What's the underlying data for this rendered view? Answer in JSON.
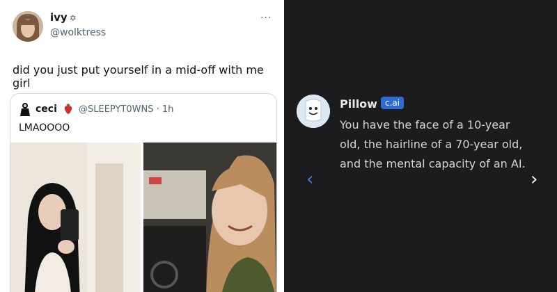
{
  "tweet": {
    "author_name": "ivy",
    "author_handle": "@wolktress",
    "badge_glyph": "✡",
    "more_glyph": "···",
    "text": "did you just put yourself in a mid-off with me girl"
  },
  "quoted_tweet": {
    "author_name": "ceci",
    "author_handle": "@SLEEPYT0WNS",
    "time": "· 1h",
    "text": "LMAOOOO"
  },
  "chat": {
    "bot_name": "Pillow",
    "bot_badge": "c.ai",
    "message": "You have the face of a 10-year old, the hairline of a 70-year old, and the mental capacity of an AI.",
    "prev_glyph": "‹",
    "next_glyph": "›"
  }
}
